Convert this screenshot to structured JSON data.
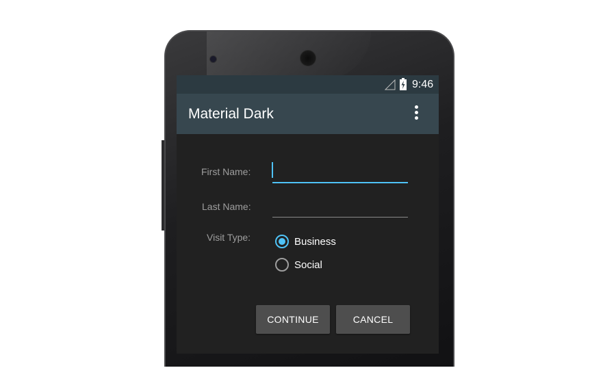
{
  "status_bar": {
    "time": "9:46",
    "signal_icon": "signal-icon",
    "battery_icon": "battery-charging-icon"
  },
  "app_bar": {
    "title": "Material Dark",
    "menu_icon": "overflow-menu-icon"
  },
  "form": {
    "first_name": {
      "label": "First Name:",
      "value": "",
      "placeholder": ""
    },
    "last_name": {
      "label": "Last Name:",
      "value": "",
      "placeholder": ""
    },
    "visit_type": {
      "label": "Visit Type:",
      "options": [
        {
          "label": "Business",
          "selected": true
        },
        {
          "label": "Social",
          "selected": false
        }
      ]
    }
  },
  "actions": {
    "continue_label": "CONTINUE",
    "cancel_label": "CANCEL"
  },
  "colors": {
    "accent": "#4fc3f7",
    "app_bar": "#37474f",
    "status_bar": "#2c3a41",
    "background": "#212121",
    "button": "#4e4e4e"
  }
}
